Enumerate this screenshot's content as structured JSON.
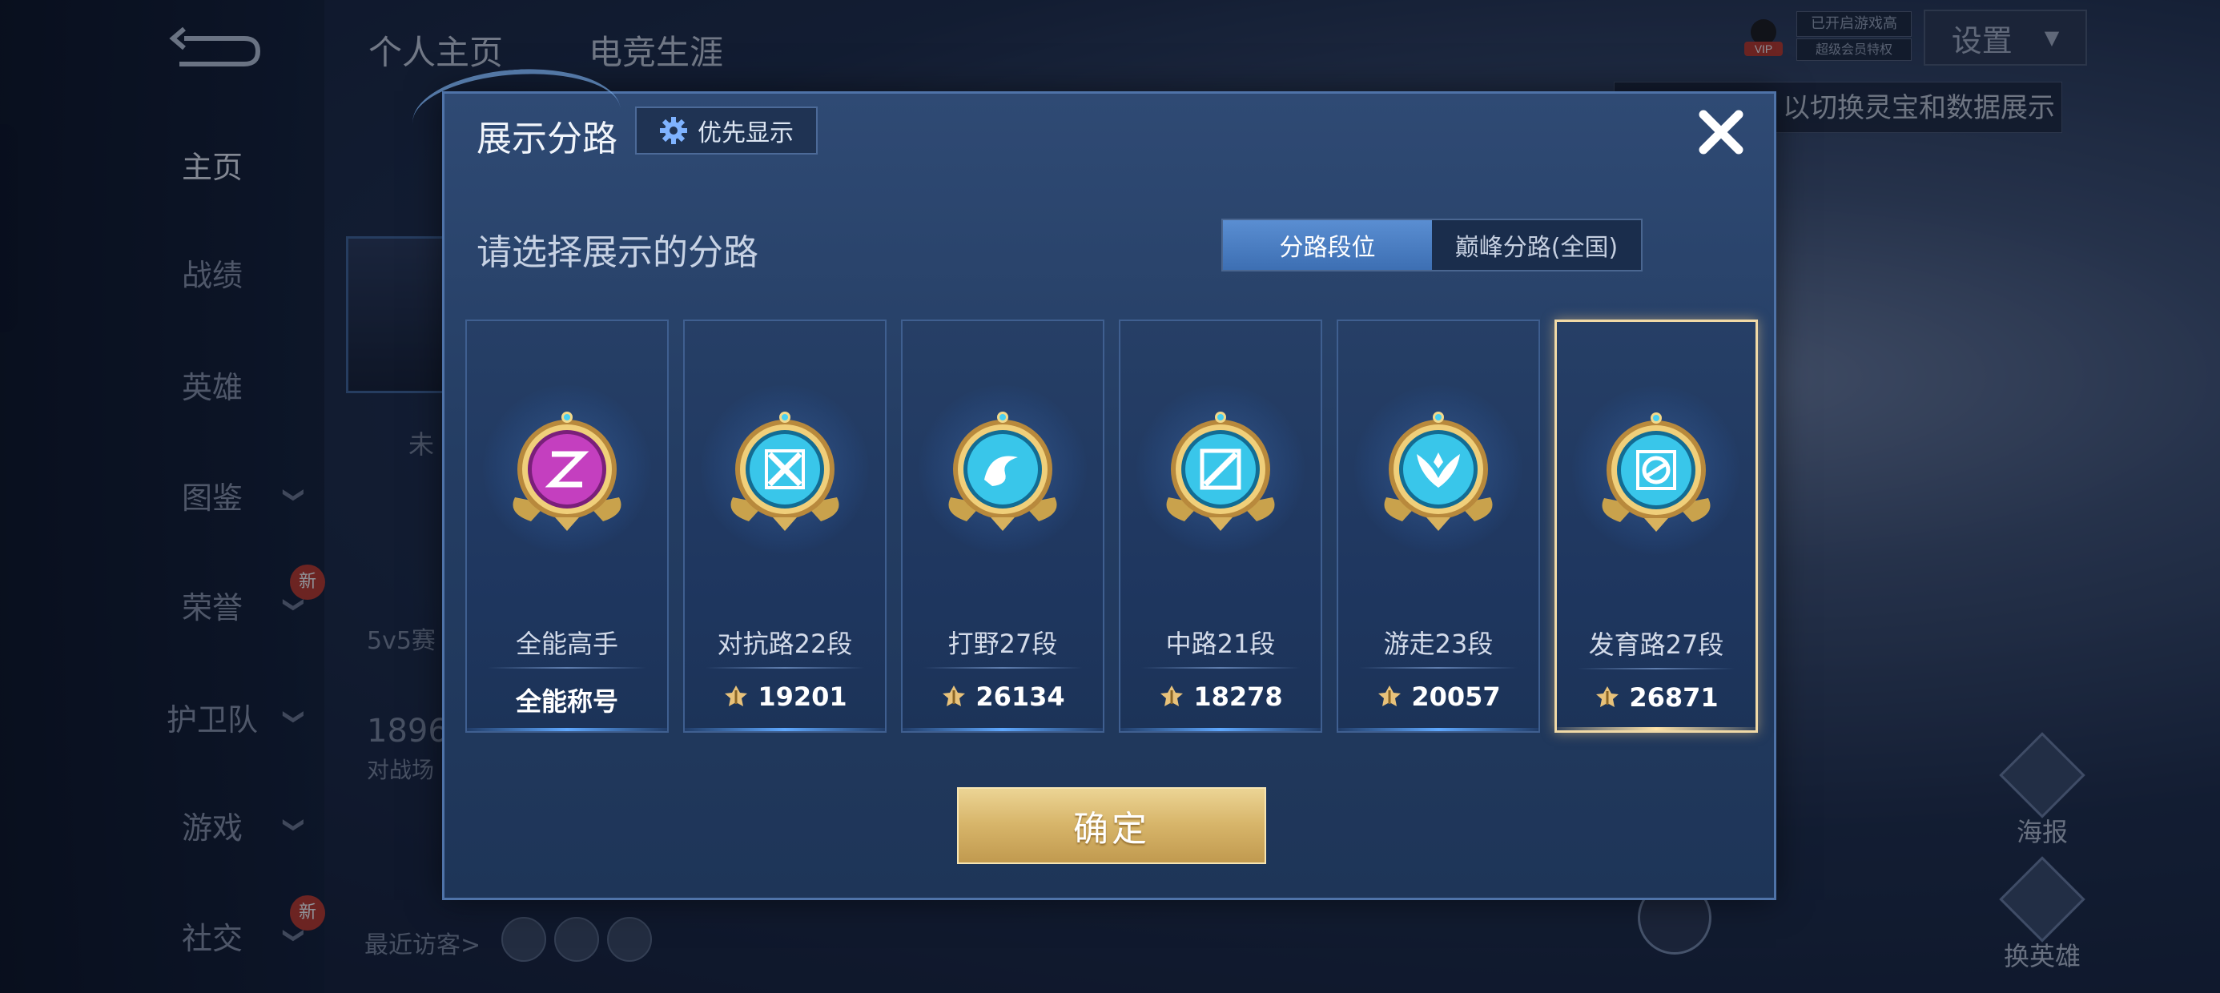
{
  "background": {
    "tabs": [
      "个人主页",
      "电竞生涯"
    ],
    "nav": [
      {
        "label": "主页",
        "chevron": false,
        "new": false,
        "active": true
      },
      {
        "label": "战绩",
        "chevron": false,
        "new": false,
        "active": false
      },
      {
        "label": "英雄",
        "chevron": false,
        "new": false,
        "active": false
      },
      {
        "label": "图鉴",
        "chevron": true,
        "new": false,
        "active": false
      },
      {
        "label": "荣誉",
        "chevron": true,
        "new": true,
        "active": false
      },
      {
        "label": "护卫队",
        "chevron": true,
        "new": false,
        "active": false
      },
      {
        "label": "游戏",
        "chevron": true,
        "new": false,
        "active": false
      },
      {
        "label": "社交",
        "chevron": true,
        "new": true,
        "active": false
      }
    ],
    "new_badge": "新",
    "unknown_text": "未",
    "mode_text": "5v5赛",
    "count_text": "1896",
    "battle_text": "对战场",
    "visitor_text": "最近访客>",
    "vip_line1": "已开启游戏高",
    "vip_line2": "超级会员特权",
    "vip_label": "VIP",
    "settings_label": "设置",
    "hint_text": "以切换灵宝和数据展示",
    "right_buttons": [
      "海报",
      "换英雄"
    ]
  },
  "modal": {
    "title": "展示分路",
    "priority_label": "优先显示",
    "subtitle": "请选择展示的分路",
    "tabs": [
      {
        "label": "分路段位",
        "active": true
      },
      {
        "label": "巅峰分路(全国)",
        "active": false
      }
    ],
    "cards": [
      {
        "name": "全能高手",
        "value": "全能称号",
        "has_score_icon": false,
        "badge": "all-round",
        "selected": false
      },
      {
        "name": "对抗路22段",
        "value": "19201",
        "has_score_icon": true,
        "badge": "clash-lane",
        "selected": false
      },
      {
        "name": "打野27段",
        "value": "26134",
        "has_score_icon": true,
        "badge": "jungle",
        "selected": false
      },
      {
        "name": "中路21段",
        "value": "18278",
        "has_score_icon": true,
        "badge": "mid-lane",
        "selected": false
      },
      {
        "name": "游走23段",
        "value": "20057",
        "has_score_icon": true,
        "badge": "roam",
        "selected": false
      },
      {
        "name": "发育路27段",
        "value": "26871",
        "has_score_icon": true,
        "badge": "farm-lane",
        "selected": true
      }
    ],
    "confirm_label": "确定"
  },
  "colors": {
    "accent_gold": "#d7b56a",
    "selected_border": "#f0d9a6",
    "active_tab": "#4a80c4",
    "badge_cyan": "#39c6ea",
    "badge_magenta": "#c43fbf"
  }
}
